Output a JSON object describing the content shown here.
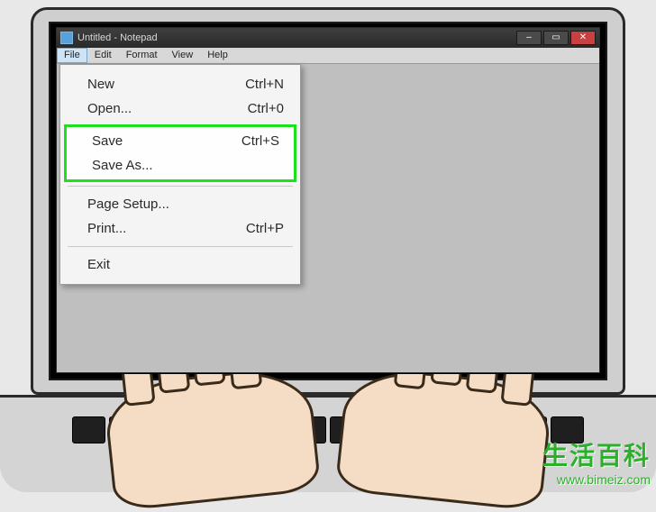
{
  "window": {
    "title": "Untitled - Notepad"
  },
  "menubar": {
    "items": [
      "File",
      "Edit",
      "Format",
      "View",
      "Help"
    ]
  },
  "fileMenu": {
    "new": {
      "label": "New",
      "shortcut": "Ctrl+N"
    },
    "open": {
      "label": "Open...",
      "shortcut": "Ctrl+0"
    },
    "save": {
      "label": "Save",
      "shortcut": "Ctrl+S"
    },
    "saveAs": {
      "label": "Save As..."
    },
    "pageSetup": {
      "label": "Page Setup..."
    },
    "print": {
      "label": "Print...",
      "shortcut": "Ctrl+P"
    },
    "exit": {
      "label": "Exit"
    }
  },
  "watermark": {
    "main": "生活百科",
    "sub": "www.bimeiz.com"
  }
}
